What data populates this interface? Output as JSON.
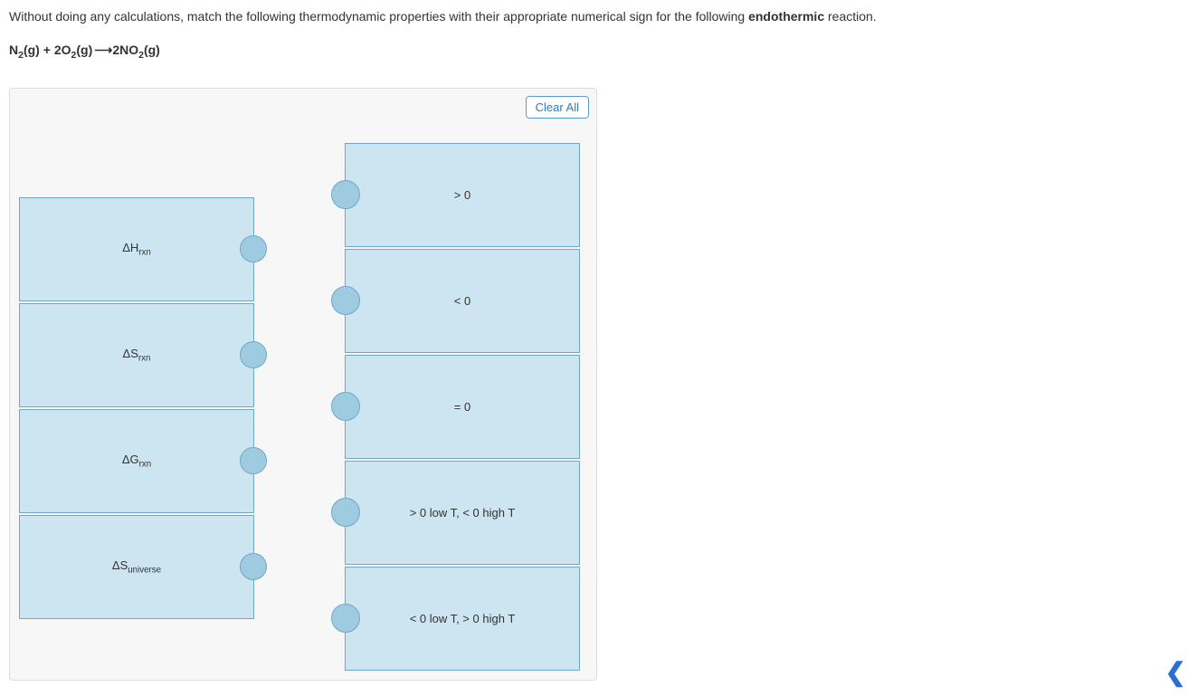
{
  "question": {
    "preText": "Without doing any calculations, match the following thermodynamic properties with their appropriate numerical sign for the following ",
    "boldWord": "endothermic",
    "postText": " reaction."
  },
  "equation": {
    "lhs1_base": "N",
    "lhs1_sub": "2",
    "lhs1_phase": "(g)",
    "plus": " + ",
    "lhs2_coef": "2",
    "lhs2_base": "O",
    "lhs2_sub": "2",
    "lhs2_phase": "(g)",
    "arrow": "⟶",
    "rhs_coef": "2",
    "rhs_base": "NO",
    "rhs_sub": "2",
    "rhs_phase": "(g)"
  },
  "controls": {
    "clearAll": "Clear All"
  },
  "leftTiles": [
    {
      "delta": "Δ",
      "mainSub": "H",
      "subSub": "rxn"
    },
    {
      "delta": "Δ",
      "mainSub": "S",
      "subSub": "rxn"
    },
    {
      "delta": "Δ",
      "mainSub": "G",
      "subSub": "rxn"
    },
    {
      "delta": "Δ",
      "mainSub": "S",
      "subSub": "universe"
    }
  ],
  "rightTiles": [
    {
      "label": "> 0"
    },
    {
      "label": "< 0"
    },
    {
      "label": "= 0"
    },
    {
      "label": "> 0 low T, < 0 high T"
    },
    {
      "label": "< 0 low T, > 0 high T"
    }
  ],
  "nav": {
    "chevron": "❮"
  }
}
